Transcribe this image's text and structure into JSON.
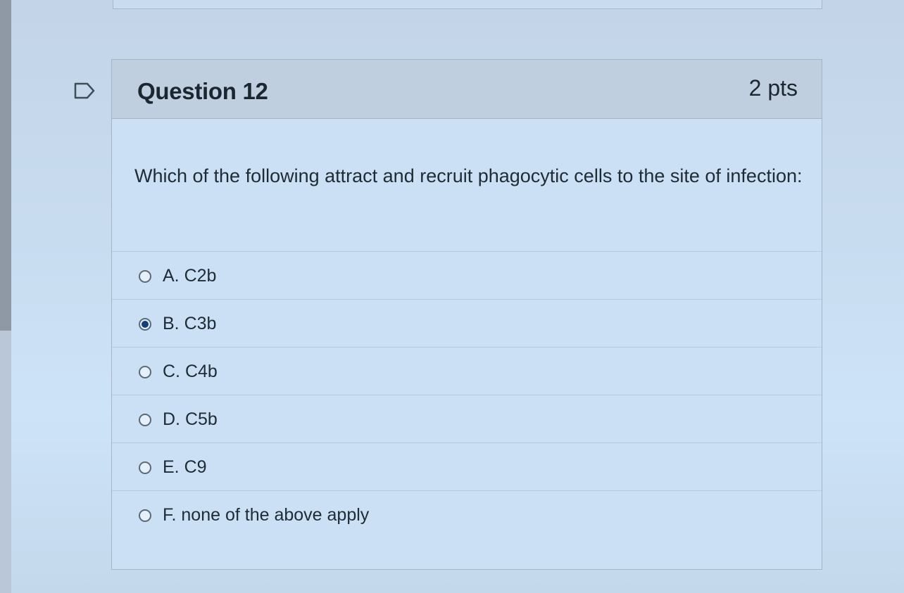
{
  "question": {
    "title": "Question 12",
    "points": "2 pts",
    "text": "Which of the following attract and recruit phagocytic cells to the site of infection:",
    "flag_icon": "flag-icon",
    "answers": [
      {
        "label": "A. C2b",
        "selected": false
      },
      {
        "label": "B. C3b",
        "selected": true
      },
      {
        "label": "C. C4b",
        "selected": false
      },
      {
        "label": "D. C5b",
        "selected": false
      },
      {
        "label": "E. C9",
        "selected": false
      },
      {
        "label": "F. none of the above apply",
        "selected": false
      }
    ]
  },
  "colors": {
    "selected_radio": "#14407a",
    "header_bg": "#bfcfe0"
  }
}
